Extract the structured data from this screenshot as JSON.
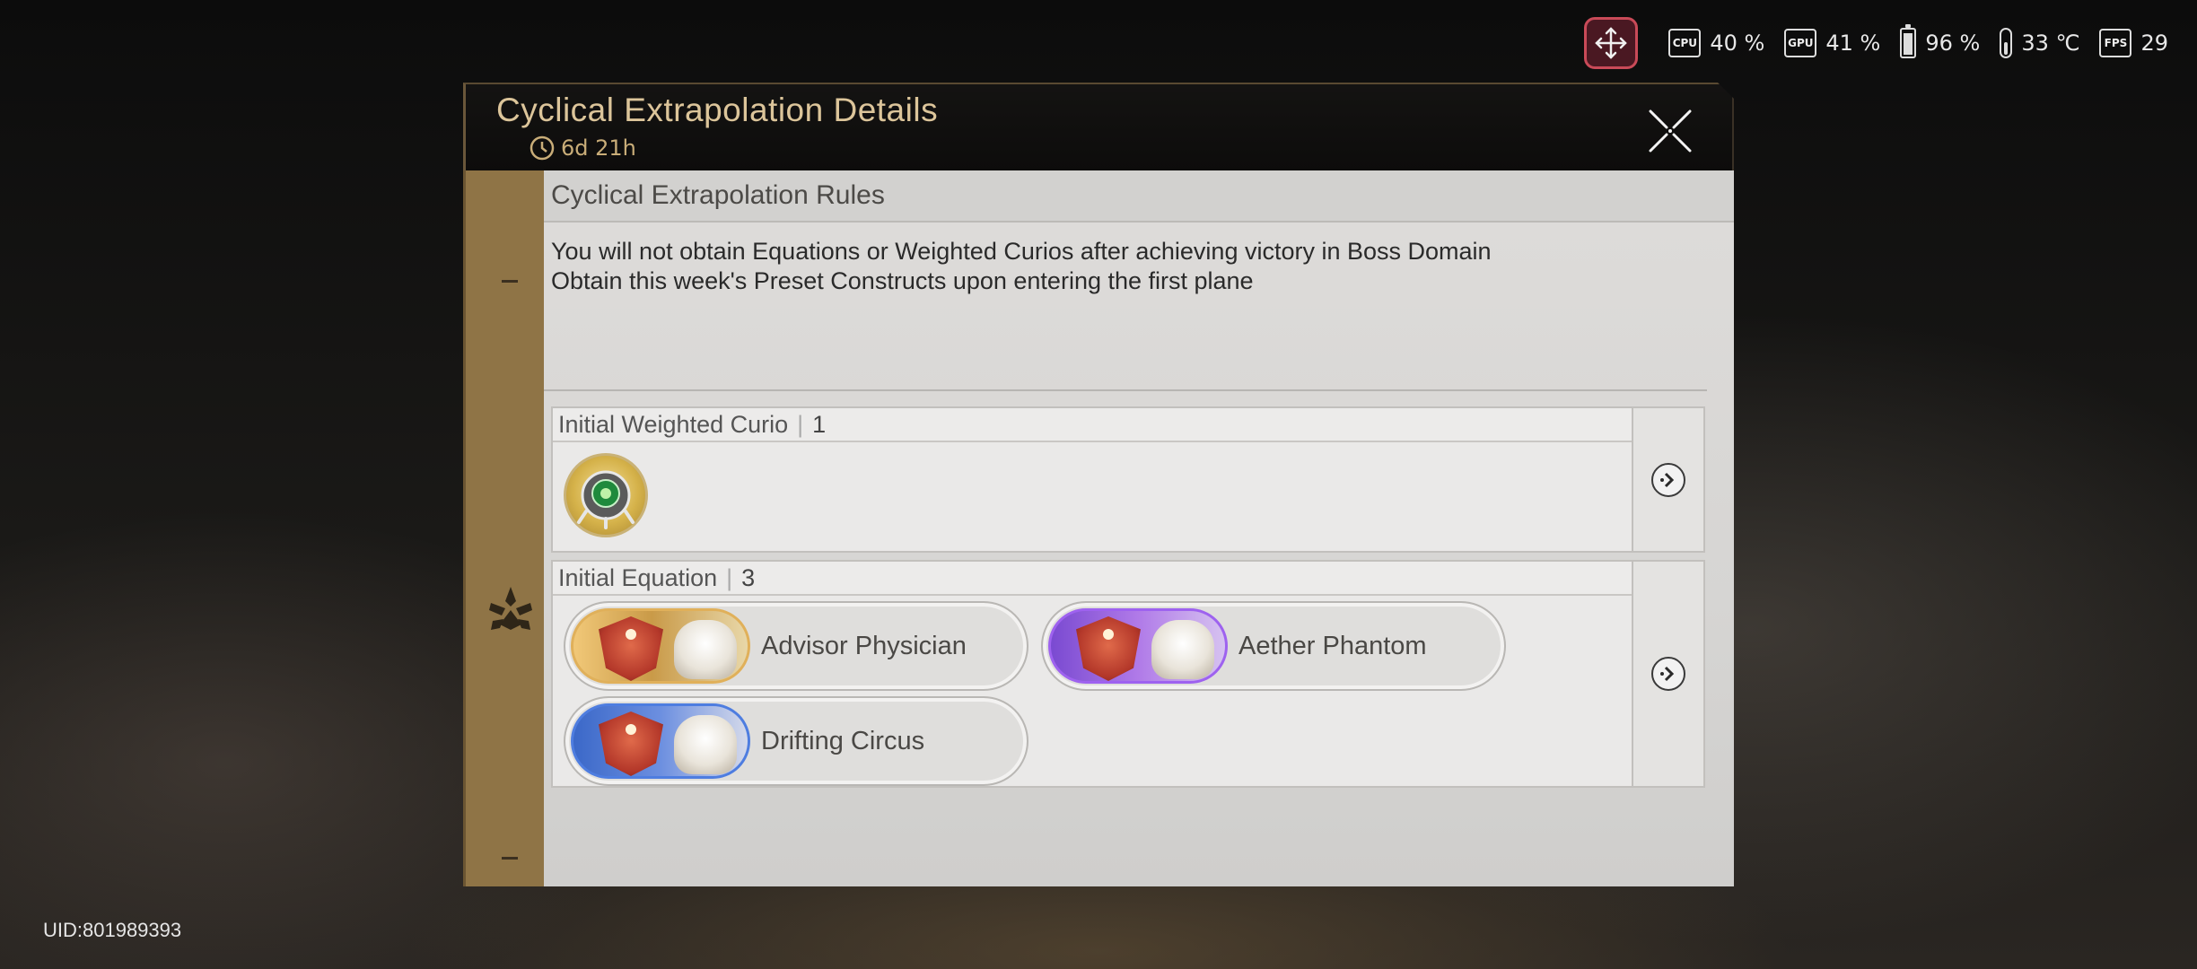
{
  "status": {
    "cpu_label": "CPU",
    "cpu": "40 %",
    "gpu_label": "GPU",
    "gpu": "41 %",
    "battery": "96 %",
    "temperature": "33 ℃",
    "fps_label": "FPS",
    "fps": "29"
  },
  "uid": "UID:801989393",
  "panel": {
    "title": "Cyclical Extrapolation Details",
    "timer": "6d 21h",
    "rules_heading": "Cyclical Extrapolation Rules",
    "rules": [
      "You will not obtain Equations or Weighted Curios after achieving victory in Boss Domain",
      "Obtain this week's Preset Constructs upon entering the first plane"
    ],
    "curio_section": {
      "label": "Initial Weighted Curio",
      "sep": "|",
      "count": "1"
    },
    "equation_section": {
      "label": "Initial Equation",
      "sep": "|",
      "count": "3"
    },
    "equations": [
      {
        "name": "Advisor Physician",
        "rarity_color": "#e0b05a"
      },
      {
        "name": "Aether Phantom",
        "rarity_color": "#9e62ef"
      },
      {
        "name": "Drifting Circus",
        "rarity_color": "#4e7de0"
      }
    ]
  },
  "colors": {
    "accent_gold": "#dcc59a",
    "sidebar": "#8f7446",
    "move_button": "#c94a58"
  }
}
